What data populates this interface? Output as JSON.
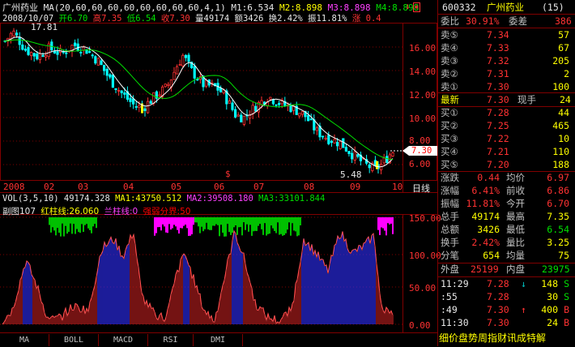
{
  "header": {
    "stock_name": "广州药业",
    "ma_label": "MA(20,60,60,60,60,60,60,60,60,4,1)",
    "m1": "M1:6.534",
    "m2": "M2:8.898",
    "m3": "M3:8.898",
    "m4": "M4:8.898",
    "date": "2008/10/07",
    "open": "开6.70",
    "high": "高7.35",
    "low": "低6.54",
    "close": "收7.30",
    "volume": "量49174",
    "amount": "额3426",
    "turnover": "换2.42%",
    "amplitude": "振11.81%",
    "change_label": "涨 0.4"
  },
  "price_axis": [
    "16.00",
    "14.00",
    "12.00",
    "10.00",
    "8.00",
    "6.00"
  ],
  "price_annotations": {
    "high": "17.81",
    "low": "5.48",
    "last": "7.30"
  },
  "time_axis": [
    "2008",
    "02",
    "03",
    "04",
    "05",
    "06",
    "07",
    "08",
    "09",
    "10"
  ],
  "period_label": "日线",
  "volume_info": {
    "vol": "VOL(3,5,10)",
    "vol_value": "49174.328",
    "ma1": "MA1:43750.512",
    "ma2": "MA2:39508.180",
    "ma3": "MA3:33101.844"
  },
  "sub_info": {
    "name": "副图107",
    "red": "红柱线:26.060",
    "blue": "兰柱线:0",
    "zone": "强弱分界:50"
  },
  "sub_axis": [
    "150.00",
    "100.00",
    "50.00",
    "0.00"
  ],
  "tabs": [
    "MA",
    "BOLL",
    "MACD",
    "RSI",
    "DMI"
  ],
  "panel": {
    "code": "600332",
    "name": "广州药业",
    "rank": "(15)",
    "weibi_label": "委比",
    "weibi_value": "30.91%",
    "weicha_label": "委差",
    "weicha_value": "386",
    "asks": [
      {
        "label": "卖⑤",
        "price": "7.34",
        "vol": "57"
      },
      {
        "label": "卖④",
        "price": "7.33",
        "vol": "67"
      },
      {
        "label": "卖③",
        "price": "7.32",
        "vol": "205"
      },
      {
        "label": "卖②",
        "price": "7.31",
        "vol": "2"
      },
      {
        "label": "卖①",
        "price": "7.30",
        "vol": "100"
      }
    ],
    "latest_label": "最新",
    "latest_value": "7.30",
    "xianshou_label": "现手",
    "xianshou_value": "24",
    "bids": [
      {
        "label": "买①",
        "price": "7.28",
        "vol": "44"
      },
      {
        "label": "买②",
        "price": "7.25",
        "vol": "465"
      },
      {
        "label": "买③",
        "price": "7.22",
        "vol": "10"
      },
      {
        "label": "买④",
        "price": "7.21",
        "vol": "110"
      },
      {
        "label": "买⑤",
        "price": "7.20",
        "vol": "188"
      }
    ],
    "stats": [
      {
        "l1": "涨跌",
        "v1": "0.44",
        "l2": "均价",
        "v2": "6.97"
      },
      {
        "l1": "涨幅",
        "v1": "6.41%",
        "l2": "前收",
        "v2": "6.86"
      },
      {
        "l1": "振幅",
        "v1": "11.81%",
        "l2": "今开",
        "v2": "6.70"
      },
      {
        "l1": "总手",
        "v1": "49174",
        "l2": "最高",
        "v2": "7.35"
      },
      {
        "l1": "总额",
        "v1": "3426",
        "l2": "最低",
        "v2": "6.54"
      },
      {
        "l1": "换手",
        "v1": "2.42%",
        "l2": "量比",
        "v2": "3.25"
      },
      {
        "l1": "分笔",
        "v1": "654",
        "l2": "均量",
        "v2": "75"
      }
    ],
    "outer_label": "外盘",
    "outer_value": "25199",
    "inner_label": "内盘",
    "inner_value": "23975",
    "ticks": [
      {
        "time": "11:29",
        "price": "7.28",
        "arrow": "↓",
        "vol": "148",
        "flag": "S"
      },
      {
        "time": ":55",
        "price": "7.28",
        "arrow": "",
        "vol": "30",
        "flag": "S"
      },
      {
        "time": ":49",
        "price": "7.30",
        "arrow": "↑",
        "vol": "400",
        "flag": "B"
      },
      {
        "time": "11:30",
        "price": "7.30",
        "arrow": "",
        "vol": "24",
        "flag": "B"
      }
    ],
    "bottom_links": "细价盘势周指财讯成特解"
  },
  "colors": {
    "up": "#ff3232",
    "down": "#00ffff",
    "ma_white": "#ffffff",
    "ma_green": "#00e000",
    "frame": "#800000"
  }
}
